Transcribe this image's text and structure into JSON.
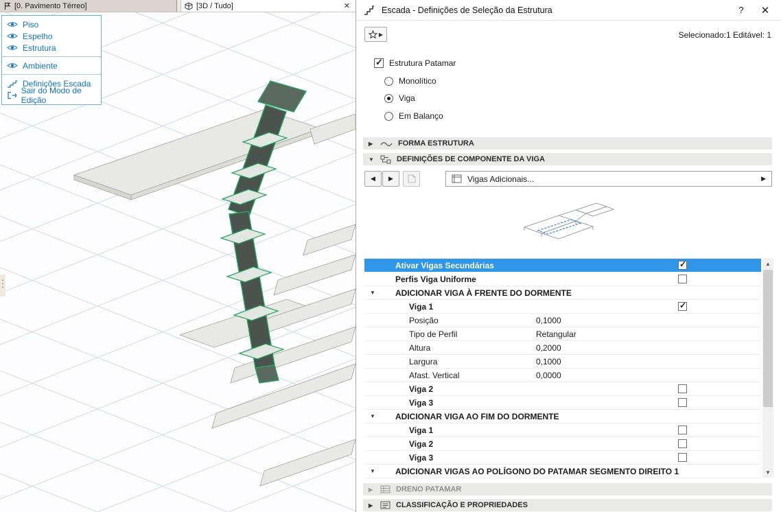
{
  "viewport": {
    "tabs": [
      {
        "label": "[0. Pavimento Térreo]"
      },
      {
        "label": "[3D / Tudo]",
        "close": "✕"
      }
    ],
    "edit_panel": {
      "items": [
        {
          "label": "Piso"
        },
        {
          "label": "Espelho"
        },
        {
          "label": "Estrutura"
        },
        {
          "label": "Ambiente"
        },
        {
          "label": "Definições Escada"
        },
        {
          "label": "Sair do Modo de Edição"
        }
      ]
    }
  },
  "dialog": {
    "title": "Escada - Definições de Seleção da Estrutura",
    "help_label": "?",
    "close_label": "✕",
    "status": "Selecionado:1 Editável: 1",
    "patamar_checkbox": {
      "label": "Estrutura Patamar",
      "checked": true
    },
    "structure_type_radios": [
      {
        "label": "Monolítico",
        "selected": false
      },
      {
        "label": "Viga",
        "selected": true
      },
      {
        "label": "Em Balanço",
        "selected": false
      }
    ],
    "sections": {
      "forma_estrutura": "FORMA ESTRUTURA",
      "componentes_viga": "DEFINIÇÕES DE COMPONENTE DA VIGA",
      "dreno_patamar": "DRENO PATAMAR",
      "classificacao": "CLASSIFICAÇÃO E PROPRIEDADES"
    },
    "component_selector": {
      "value": "Vigas Adicionais..."
    },
    "beam_table": {
      "rows": [
        {
          "type": "toggle",
          "label": "Ativar Vigas Secundárias",
          "checked": true,
          "selected": true,
          "indent": 1
        },
        {
          "type": "toggle",
          "label": "Perfis Viga Uniforme",
          "checked": false,
          "indent": 1
        },
        {
          "type": "group",
          "label": "ADICIONAR VIGA À FRENTE DO DORMENTE"
        },
        {
          "type": "toggle",
          "label": "Viga 1",
          "checked": true,
          "indent": 2
        },
        {
          "type": "prop",
          "label": "Posição",
          "value": "0,1000"
        },
        {
          "type": "prop",
          "label": "Tipo de Perfil",
          "value": "Retangular"
        },
        {
          "type": "prop",
          "label": "Altura",
          "value": "0,2000"
        },
        {
          "type": "prop",
          "label": "Largura",
          "value": "0,1000"
        },
        {
          "type": "prop",
          "label": "Afast. Vertical",
          "value": "0,0000"
        },
        {
          "type": "toggle",
          "label": "Viga 2",
          "checked": false,
          "indent": 2
        },
        {
          "type": "toggle",
          "label": "Viga 3",
          "checked": false,
          "indent": 2
        },
        {
          "type": "group",
          "label": "ADICIONAR VIGA AO FIM DO DORMENTE"
        },
        {
          "type": "toggle",
          "label": "Viga 1",
          "checked": false,
          "indent": 2
        },
        {
          "type": "toggle",
          "label": "Viga 2",
          "checked": false,
          "indent": 2
        },
        {
          "type": "toggle",
          "label": "Viga 3",
          "checked": false,
          "indent": 2
        },
        {
          "type": "group",
          "label": "ADICIONAR VIGAS AO POLÍGONO DO PATAMAR SEGMENTO DIREITO 1"
        }
      ]
    },
    "colors": {
      "selection_blue": "#2f96e8",
      "highlight_green": "#2aa35f"
    }
  }
}
